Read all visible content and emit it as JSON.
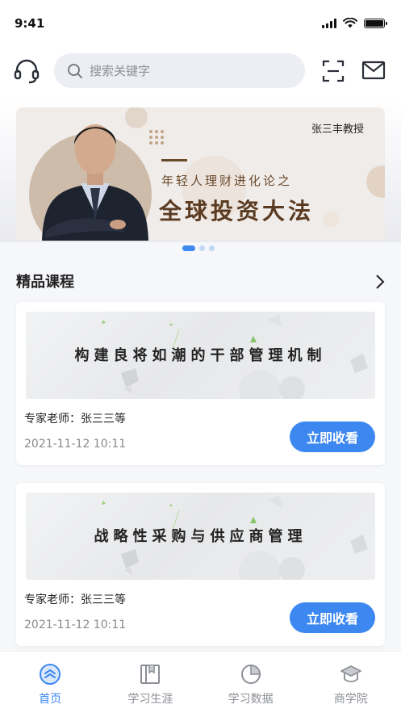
{
  "status_bar": {
    "time": "9:41"
  },
  "header": {
    "search_placeholder": "搜索关键字"
  },
  "banner": {
    "professor": "张三丰教授",
    "subtitle": "年轻人理财进化论之",
    "title": "全球投资大法"
  },
  "carousel": {
    "page_count": 3,
    "active_index": 0
  },
  "section": {
    "title": "精品课程"
  },
  "courses": [
    {
      "cover_title": "构建良将如潮的干部管理机制",
      "teacher": "专家老师：张三三等",
      "date": "2021-11-12  10:11",
      "button": "立即收看"
    },
    {
      "cover_title": "战略性采购与供应商管理",
      "teacher": "专家老师：张三三等",
      "date": "2021-11-12  10:11",
      "button": "立即收看"
    }
  ],
  "tabbar": {
    "items": [
      {
        "label": "首页",
        "icon": "home-icon",
        "active": true
      },
      {
        "label": "学习生涯",
        "icon": "book-icon",
        "active": false
      },
      {
        "label": "学习数据",
        "icon": "pie-chart-icon",
        "active": false
      },
      {
        "label": "商学院",
        "icon": "graduation-cap-icon",
        "active": false
      }
    ]
  },
  "colors": {
    "accent": "#3d88f0",
    "banner_brown": "#5b3c22",
    "muted_text": "#8a8a8a"
  }
}
